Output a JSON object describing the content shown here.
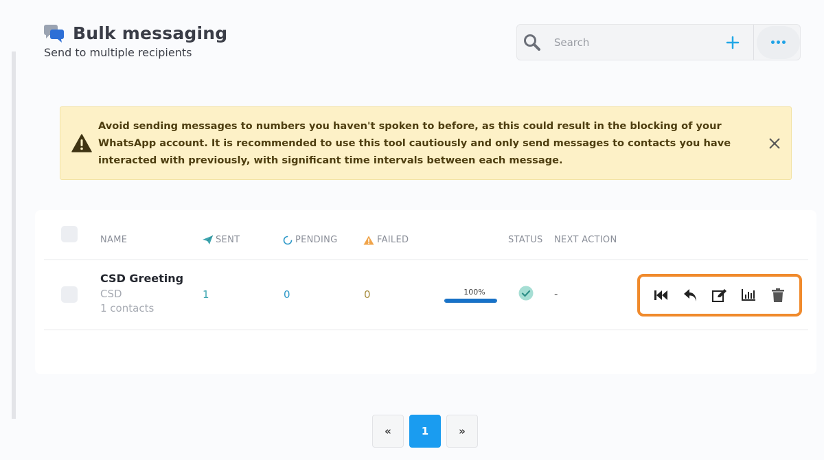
{
  "header": {
    "title": "Bulk messaging",
    "subtitle": "Send to multiple recipients"
  },
  "search": {
    "placeholder": "Search"
  },
  "warning": {
    "text": "Avoid sending messages to numbers you haven't spoken to before, as this could result in the blocking of your WhatsApp account. It is recommended to use this tool cautiously and only send messages to contacts you have interacted with previously, with significant time intervals between each message."
  },
  "table": {
    "columns": {
      "name": "NAME",
      "sent": "SENT",
      "pending": "PENDING",
      "failed": "FAILED",
      "status": "STATUS",
      "next_action": "NEXT ACTION"
    },
    "rows": [
      {
        "name": "CSD Greeting",
        "label": "CSD",
        "contacts": "1 contacts",
        "sent": "1",
        "pending": "0",
        "failed": "0",
        "progress_text": "100%",
        "progress_value": 100,
        "next_action": "-"
      }
    ]
  },
  "pagination": {
    "prev": "«",
    "current": "1",
    "next": "»"
  },
  "colors": {
    "accent": "#1a9cf0",
    "highlight": "#f08a2c",
    "warning_bg": "#fdf1c7",
    "status_ok": "#3fb8a8"
  }
}
